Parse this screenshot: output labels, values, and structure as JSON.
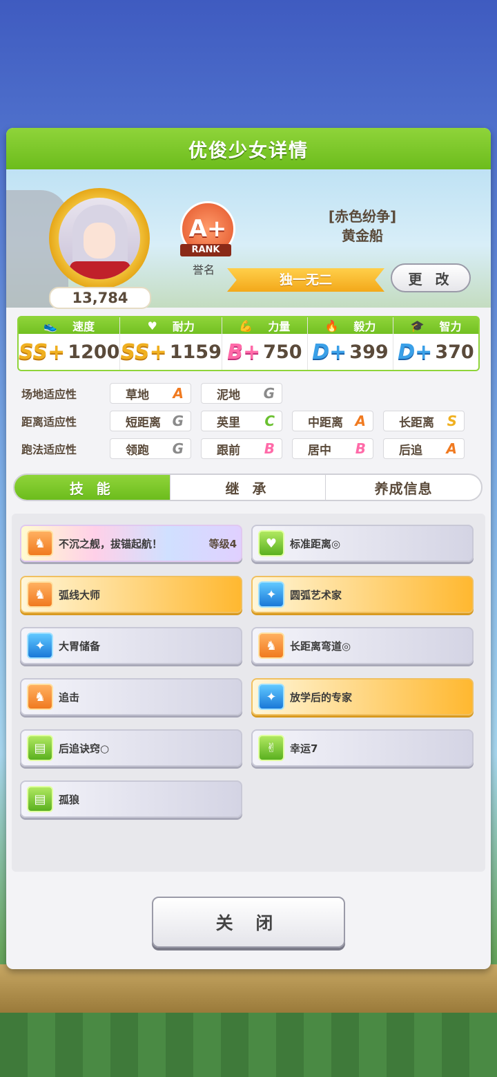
{
  "title": "优俊少女详情",
  "character": {
    "fans": "13,784",
    "rank_grade": "A+",
    "rank_tag": "RANK",
    "rank_label": "誉名",
    "costume": "[赤色纷争]",
    "name": "黄金船",
    "unique_title": "独一无二",
    "change_button": "更 改"
  },
  "stats": [
    {
      "label": "速度",
      "icon": "shoe-icon",
      "grade": "SS+",
      "value": "1200"
    },
    {
      "label": "耐力",
      "icon": "heart-icon",
      "grade": "SS+",
      "value": "1159"
    },
    {
      "label": "力量",
      "icon": "muscle-icon",
      "grade": "B+",
      "value": "750"
    },
    {
      "label": "毅力",
      "icon": "flame-icon",
      "grade": "D+",
      "value": "399"
    },
    {
      "label": "智力",
      "icon": "graduation-cap-icon",
      "grade": "D+",
      "value": "370"
    }
  ],
  "aptitudes": {
    "track": {
      "label": "场地适应性",
      "items": [
        {
          "name": "草地",
          "grade": "A"
        },
        {
          "name": "泥地",
          "grade": "G"
        }
      ]
    },
    "distance": {
      "label": "距离适应性",
      "items": [
        {
          "name": "短距离",
          "grade": "G"
        },
        {
          "name": "英里",
          "grade": "C"
        },
        {
          "name": "中距离",
          "grade": "A"
        },
        {
          "name": "长距离",
          "grade": "S"
        }
      ]
    },
    "strategy": {
      "label": "跑法适应性",
      "items": [
        {
          "name": "领跑",
          "grade": "G"
        },
        {
          "name": "跟前",
          "grade": "B"
        },
        {
          "name": "居中",
          "grade": "B"
        },
        {
          "name": "后追",
          "grade": "A"
        }
      ]
    }
  },
  "tabs": [
    "技 能",
    "继 承",
    "养成信息"
  ],
  "skills": [
    {
      "name": "不沉之舰，拔锚起航！",
      "level": "等级4",
      "style": "rainbow",
      "icon": "running-horse-icon"
    },
    {
      "name": "标准距离◎",
      "style": "silver",
      "icon": "heart-icon"
    },
    {
      "name": "弧线大师",
      "style": "gold",
      "icon": "running-horse-icon"
    },
    {
      "name": "圆弧艺术家",
      "style": "gold",
      "icon": "sparkle-icon"
    },
    {
      "name": "大胃储备",
      "style": "silver",
      "icon": "sparkle-icon"
    },
    {
      "name": "长距离弯道◎",
      "style": "silver",
      "icon": "running-horse-icon"
    },
    {
      "name": "追击",
      "style": "silver",
      "icon": "running-horse-icon"
    },
    {
      "name": "放学后的专家",
      "style": "gold",
      "icon": "sparkle-icon"
    },
    {
      "name": "后追诀窍○",
      "style": "silver",
      "icon": "book-icon"
    },
    {
      "name": "幸运7",
      "style": "silver",
      "icon": "cheer-icon"
    },
    {
      "name": "孤狼",
      "style": "silver",
      "icon": "book-icon"
    }
  ],
  "close_button": "关 闭"
}
